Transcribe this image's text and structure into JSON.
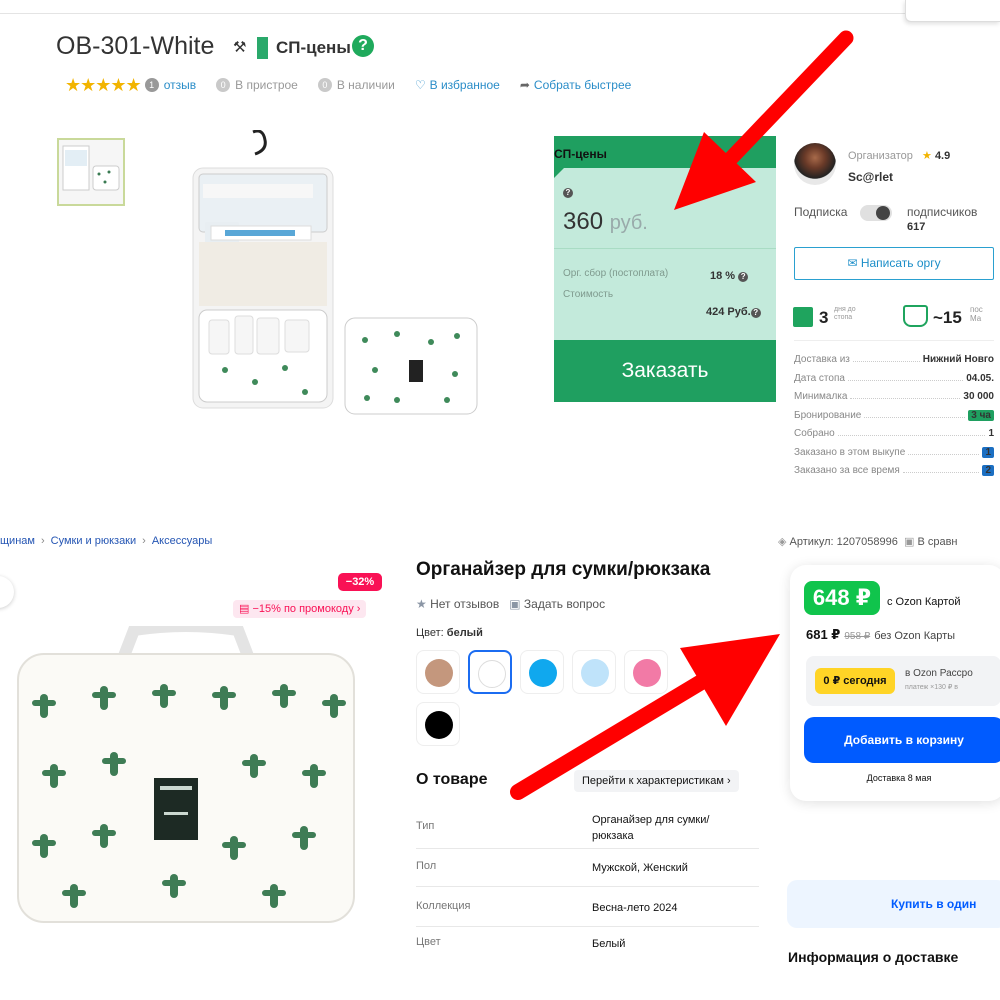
{
  "top": {
    "title": "OB-301-White",
    "sp_label": "СП-цены",
    "reviews_count": "1",
    "reviews_label": "отзыв",
    "pristroy_count": "0",
    "pristroy_label": "В пристрое",
    "instock_count": "0",
    "instock_label": "В наличии",
    "favorite_label": "В избранное",
    "faster_label": "Собрать быстрее",
    "price_card": {
      "header": "СП-цены",
      "price": "360",
      "currency": "руб.",
      "org_fee_label": "Орг. сбор (постоплата)",
      "org_fee_value": "18 %",
      "cost_label": "Стоимость",
      "cost_value": "424 Руб.",
      "order_button": "Заказать"
    },
    "organizer": {
      "label": "Организатор",
      "rating": "4.9",
      "name": "Sc@rlet",
      "subscription_label": "Подписка",
      "subscribers_label": "подписчиков",
      "subscribers_count": "617",
      "write_button": "Написать оргу",
      "days_number": "3",
      "days_label": "дня до\nстопа",
      "approx_number": "~15",
      "approx_label": "пос\nМа"
    },
    "info_rows": [
      {
        "label": "Доставка из",
        "value": "Нижний Новго",
        "badge": ""
      },
      {
        "label": "Дата стопа",
        "value": "04.05.",
        "badge": ""
      },
      {
        "label": "Минималка",
        "value": "30 000",
        "badge": ""
      },
      {
        "label": "Бронирование",
        "value": "3 ча",
        "badge": "green"
      },
      {
        "label": "Собрано",
        "value": "1",
        "badge": ""
      },
      {
        "label": "Заказано в этом выкупе",
        "value": "1",
        "badge": "blue"
      },
      {
        "label": "Заказано за все время",
        "value": "2",
        "badge": "blue"
      }
    ]
  },
  "bottom": {
    "breadcrumbs": [
      "щинам",
      "Сумки и рюкзаки",
      "Аксессуары"
    ],
    "article": "Артикул: 1207058996",
    "compare": "В сравн",
    "discount": "−32%",
    "promo": "−15% по промокоду",
    "product_title": "Органайзер для сумки/рюкзака",
    "no_reviews": "Нет отзывов",
    "ask_question": "Задать вопрос",
    "color_label": "Цвет:",
    "color_value": "белый",
    "about_title": "О товаре",
    "go_characteristics": "Перейти к характеристикам",
    "characteristics": [
      {
        "label": "Тип",
        "value": "Органайзер для сумки/ рюкзака"
      },
      {
        "label": "Пол",
        "value": "Мужской, Женский"
      },
      {
        "label": "Коллекция",
        "value": "Весна-лето 2024"
      },
      {
        "label": "Цвет",
        "value": "Белый"
      }
    ],
    "ozon_price": "648 ₽",
    "ozon_card_label": "с Ozon Картой",
    "price_plain": "681 ₽",
    "price_old": "958 ₽",
    "without_card": "без Ozon Карты",
    "today_label": "0 ₽ сегодня",
    "installment_title": "в Ozon Рассро",
    "installment_sub": "платеж ×130 ₽ в",
    "add_to_cart": "Добавить в корзину",
    "delivery_date": "Доставка 8 мая",
    "buy_one_click": "Купить в один",
    "delivery_info": "Информация о доставке"
  },
  "colors": {
    "accent_green": "#1f9f60",
    "ozon_blue": "#005bff",
    "ozon_green": "#10c44c",
    "discount_pink": "#f91155",
    "arrow_red": "#ff0000"
  },
  "swatches": [
    "#c4977d",
    "#ffffff",
    "#10a8ee",
    "#bfe3fa",
    "#f27aa6",
    "#000000"
  ]
}
